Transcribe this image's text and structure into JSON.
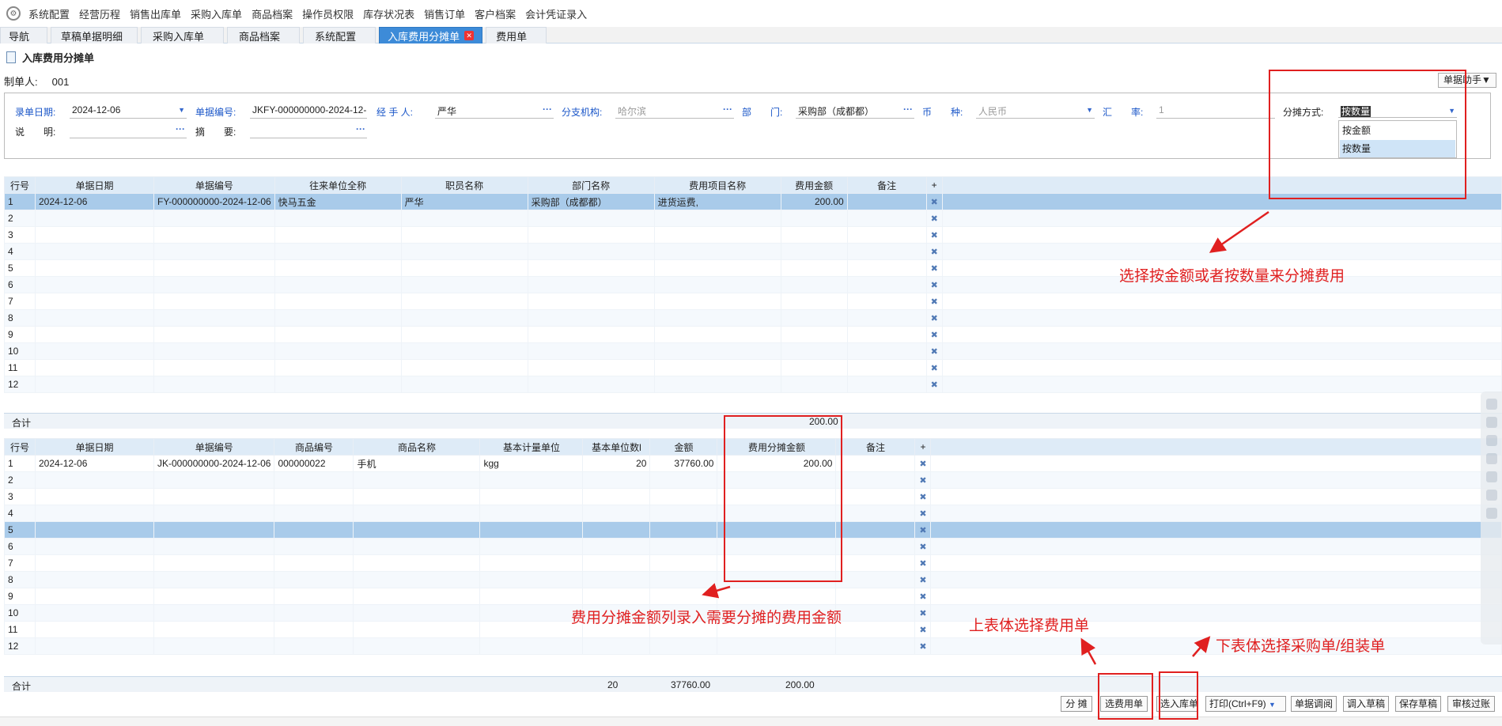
{
  "menubar": {
    "items": [
      "系统配置",
      "经营历程",
      "销售出库单",
      "采购入库单",
      "商品档案",
      "操作员权限",
      "库存状况表",
      "销售订单",
      "客户档案",
      "会计凭证录入"
    ]
  },
  "tabs": [
    {
      "label": "导航"
    },
    {
      "label": "草稿单据明细"
    },
    {
      "label": "采购入库单"
    },
    {
      "label": "商品档案"
    },
    {
      "label": "系统配置"
    },
    {
      "label": "入库费用分摊单",
      "active": true
    },
    {
      "label": "费用单"
    }
  ],
  "page": {
    "title": "入库费用分摊单",
    "maker_label": "制单人:",
    "maker_value": "001",
    "helper_button": "单据助手▼"
  },
  "form": {
    "date_label": "录单日期:",
    "date_value": "2024-12-06",
    "no_label": "单据编号:",
    "no_value": "JKFY-000000000-2024-12-",
    "handler_label": "经 手 人:",
    "handler_value": "严华",
    "branch_label": "分支机构:",
    "branch_value": "哈尔滨",
    "dept_label": "部　　门:",
    "dept_value": "采购部（成都都）",
    "currency_label": "币　　种:",
    "currency_value": "人民币",
    "rate_label": "汇　　率:",
    "rate_value": "1",
    "split_label": "分摊方式:",
    "split_value": "按数量",
    "split_options": [
      "按金额",
      "按数量"
    ],
    "note_label": "说　　明:",
    "note_value": "",
    "summary_label": "摘　　要:",
    "summary_value": ""
  },
  "upper_table": {
    "headers": [
      "行号",
      "单据日期",
      "单据编号",
      "往来单位全称",
      "职员名称",
      "部门名称",
      "费用项目名称",
      "费用金额",
      "备注",
      "+"
    ],
    "rows": [
      [
        "1",
        "2024-12-06",
        "FY-000000000-2024-12-06",
        "快马五金",
        "严华",
        "采购部（成都都）",
        "进货运费,",
        "200.00",
        ""
      ],
      [
        "2",
        "",
        "",
        "",
        "",
        "",
        "",
        "",
        ""
      ],
      [
        "3",
        "",
        "",
        "",
        "",
        "",
        "",
        "",
        ""
      ],
      [
        "4",
        "",
        "",
        "",
        "",
        "",
        "",
        "",
        ""
      ],
      [
        "5",
        "",
        "",
        "",
        "",
        "",
        "",
        "",
        ""
      ],
      [
        "6",
        "",
        "",
        "",
        "",
        "",
        "",
        "",
        ""
      ],
      [
        "7",
        "",
        "",
        "",
        "",
        "",
        "",
        "",
        ""
      ],
      [
        "8",
        "",
        "",
        "",
        "",
        "",
        "",
        "",
        ""
      ],
      [
        "9",
        "",
        "",
        "",
        "",
        "",
        "",
        "",
        ""
      ],
      [
        "10",
        "",
        "",
        "",
        "",
        "",
        "",
        "",
        ""
      ],
      [
        "11",
        "",
        "",
        "",
        "",
        "",
        "",
        "",
        ""
      ],
      [
        "12",
        "",
        "",
        "",
        "",
        "",
        "",
        "",
        ""
      ]
    ],
    "total_label": "合计",
    "total_amount": "200.00"
  },
  "lower_table": {
    "headers": [
      "行号",
      "单据日期",
      "单据编号",
      "商品编号",
      "商品名称",
      "基本计量单位",
      "基本单位数l",
      "金额",
      "费用分摊金额",
      "备注",
      "+"
    ],
    "rows": [
      [
        "1",
        "2024-12-06",
        "JK-000000000-2024-12-06",
        "000000022",
        "手机",
        "kgg",
        "20",
        "37760.00",
        "200.00",
        ""
      ],
      [
        "2",
        "",
        "",
        "",
        "",
        "",
        "",
        "",
        "",
        ""
      ],
      [
        "3",
        "",
        "",
        "",
        "",
        "",
        "",
        "",
        "",
        ""
      ],
      [
        "4",
        "",
        "",
        "",
        "",
        "",
        "",
        "",
        "",
        ""
      ],
      [
        "5",
        "",
        "",
        "",
        "",
        "",
        "",
        "",
        "",
        ""
      ],
      [
        "6",
        "",
        "",
        "",
        "",
        "",
        "",
        "",
        "",
        ""
      ],
      [
        "7",
        "",
        "",
        "",
        "",
        "",
        "",
        "",
        "",
        ""
      ],
      [
        "8",
        "",
        "",
        "",
        "",
        "",
        "",
        "",
        "",
        ""
      ],
      [
        "9",
        "",
        "",
        "",
        "",
        "",
        "",
        "",
        "",
        ""
      ],
      [
        "10",
        "",
        "",
        "",
        "",
        "",
        "",
        "",
        "",
        ""
      ],
      [
        "11",
        "",
        "",
        "",
        "",
        "",
        "",
        "",
        "",
        ""
      ],
      [
        "12",
        "",
        "",
        "",
        "",
        "",
        "",
        "",
        "",
        ""
      ]
    ],
    "total_label": "合计",
    "total_qty": "20",
    "total_amount": "37760.00",
    "total_split": "200.00"
  },
  "buttons": [
    "分 摊",
    "选费用单",
    "选入库单",
    "打印(Ctrl+F9)",
    "单据调阅",
    "调入草稿",
    "保存草稿",
    "审核过账"
  ],
  "annotations": {
    "split_method": "选择按金额或者按数量来分摊费用",
    "split_amount": "费用分摊金额列录入需要分摊的费用金额",
    "upper_select": "上表体选择费用单",
    "lower_select": "下表体选择采购单/组装单"
  },
  "colors": {
    "accent": "#3d8bd8",
    "header": "#deebf7",
    "selected_row": "#a9cbea",
    "annotation": "#e02020"
  }
}
